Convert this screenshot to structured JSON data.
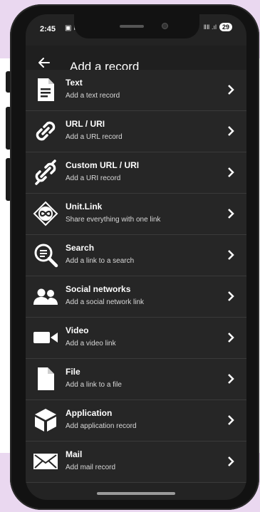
{
  "status": {
    "time": "2:45",
    "left_icons": "▣ ⋈",
    "right_icons": "ⅡⅡ .ıl",
    "battery": "29"
  },
  "appbar": {
    "title": "Add a record"
  },
  "items": [
    {
      "title": "Text",
      "subtitle": "Add a text record",
      "icon": "document-icon"
    },
    {
      "title": "URL / URI",
      "subtitle": "Add a URL record",
      "icon": "link-icon"
    },
    {
      "title": "Custom URL / URI",
      "subtitle": "Add a URI record",
      "icon": "broken-link-icon"
    },
    {
      "title": "Unit.Link",
      "subtitle": "Share everything with one link",
      "icon": "infinity-icon"
    },
    {
      "title": "Search",
      "subtitle": "Add a link to a search",
      "icon": "search-icon"
    },
    {
      "title": "Social networks",
      "subtitle": "Add a social network link",
      "icon": "people-icon"
    },
    {
      "title": "Video",
      "subtitle": "Add a video link",
      "icon": "video-camera-icon"
    },
    {
      "title": "File",
      "subtitle": "Add a link to a file",
      "icon": "file-icon"
    },
    {
      "title": "Application",
      "subtitle": "Add application record",
      "icon": "cube-icon"
    },
    {
      "title": "Mail",
      "subtitle": "Add mail record",
      "icon": "envelope-icon"
    }
  ],
  "colors": {
    "background_accent": "#ead8f0",
    "screen": "#232323",
    "text": "#ffffff"
  }
}
